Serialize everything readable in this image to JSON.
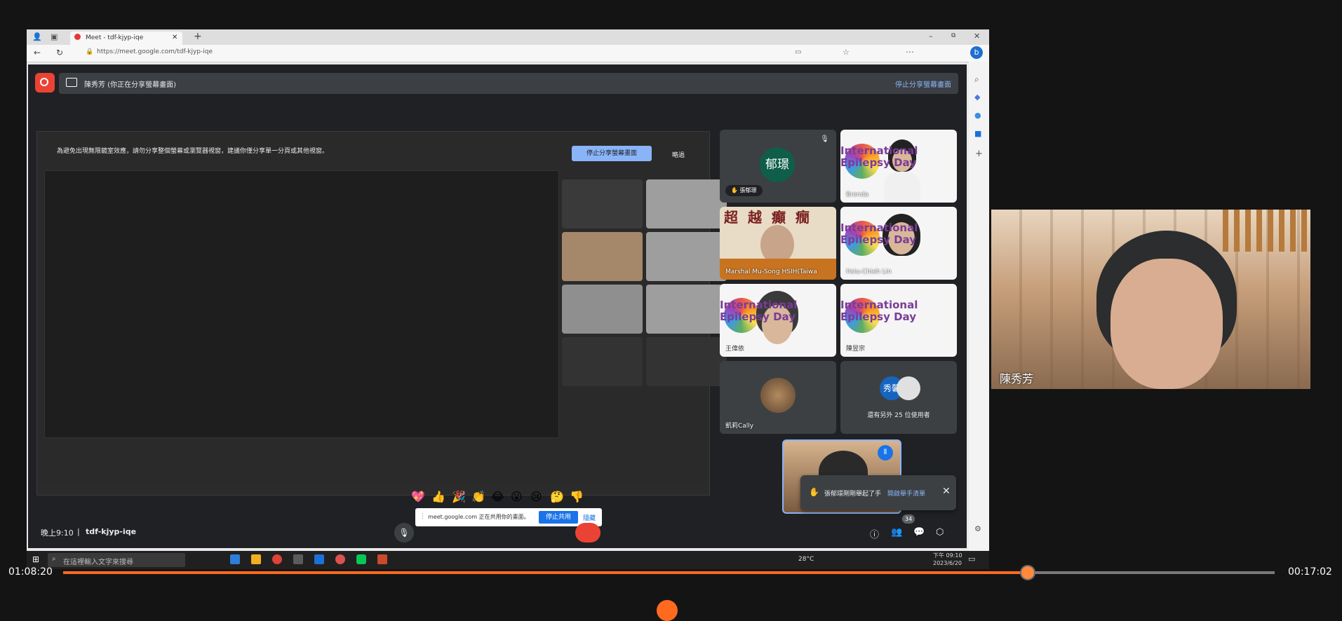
{
  "browser": {
    "tab_title": "Meet - tdf-kjyp-iqe",
    "url": "https://meet.google.com/tdf-kjyp-iqe"
  },
  "meet": {
    "presenter_banner": "陳秀芳 (你正在分享螢幕畫面)",
    "stop_sharing": "停止分享螢幕畫面",
    "share_notice": "為避免出現無限鏡室效應，請勿分享整個螢幕或瀏覽器視窗，建議你僅分享單一分頁或其他視窗。",
    "share_notice_button": "停止分享螢幕畫面",
    "share_notice_dismiss": "略過",
    "meeting_time": "晚上9:10",
    "meeting_code": "tdf-kjyp-iqe",
    "participant_count_badge": "34",
    "others_label": "還有另外 25 位使用者",
    "hand_raised_toast": "張郁璟剛剛舉起了手",
    "hand_raised_action": "開啟舉手清單",
    "sharing_bar_text": "meet.google.com 正在共用你的畫面。",
    "sharing_bar_stop": "停止共用",
    "sharing_bar_hide": "隱藏",
    "reactions": [
      "💖",
      "👍",
      "🎉",
      "👏",
      "😂",
      "😮",
      "😢",
      "🤔",
      "👎"
    ],
    "participants": [
      {
        "name": "張郁璟",
        "avatar_text": "郁璟"
      },
      {
        "name": "Brenda",
        "banner": "International Epilepsy Day"
      },
      {
        "name": "Marshal Mu-Song HSIH(Taiwa",
        "banner": "超越癲癇"
      },
      {
        "name": "Hsiu-Chieh Lin",
        "banner": "International Epilepsy Day"
      },
      {
        "name": "王偉依",
        "banner": "International Epilepsy Day"
      },
      {
        "name": "陳昱宗",
        "banner": "International Epilepsy Day"
      },
      {
        "name": "凱莉Cally"
      },
      {
        "name": "秀馨"
      }
    ]
  },
  "camera_tile": {
    "name": "陳秀芳"
  },
  "taskbar": {
    "search_placeholder": "在這裡輸入文字來搜尋",
    "temperature": "28°C",
    "clock_time": "下午 09:10",
    "clock_date": "2023/6/20"
  },
  "player": {
    "elapsed": "01:08:20",
    "remaining": "00:17:02",
    "progress_fraction": 0.796
  },
  "colors": {
    "accent": "#ff6a1f",
    "meet_bg": "#202124",
    "meet_blue": "#8ab4f8",
    "stop_blue": "#1a73e8"
  }
}
